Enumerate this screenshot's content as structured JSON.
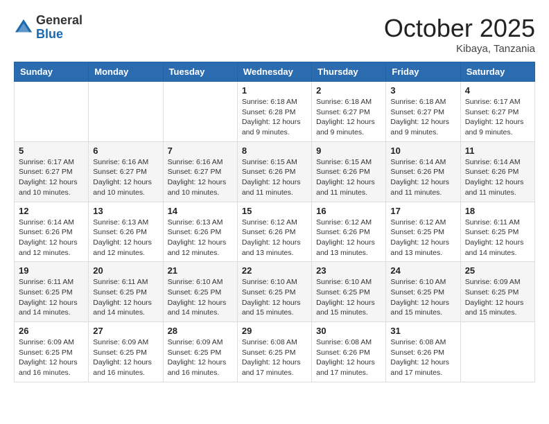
{
  "header": {
    "logo_general": "General",
    "logo_blue": "Blue",
    "month_title": "October 2025",
    "location": "Kibaya, Tanzania"
  },
  "days_of_week": [
    "Sunday",
    "Monday",
    "Tuesday",
    "Wednesday",
    "Thursday",
    "Friday",
    "Saturday"
  ],
  "weeks": [
    [
      {
        "day": "",
        "info": ""
      },
      {
        "day": "",
        "info": ""
      },
      {
        "day": "",
        "info": ""
      },
      {
        "day": "1",
        "info": "Sunrise: 6:18 AM\nSunset: 6:28 PM\nDaylight: 12 hours\nand 9 minutes."
      },
      {
        "day": "2",
        "info": "Sunrise: 6:18 AM\nSunset: 6:27 PM\nDaylight: 12 hours\nand 9 minutes."
      },
      {
        "day": "3",
        "info": "Sunrise: 6:18 AM\nSunset: 6:27 PM\nDaylight: 12 hours\nand 9 minutes."
      },
      {
        "day": "4",
        "info": "Sunrise: 6:17 AM\nSunset: 6:27 PM\nDaylight: 12 hours\nand 9 minutes."
      }
    ],
    [
      {
        "day": "5",
        "info": "Sunrise: 6:17 AM\nSunset: 6:27 PM\nDaylight: 12 hours\nand 10 minutes."
      },
      {
        "day": "6",
        "info": "Sunrise: 6:16 AM\nSunset: 6:27 PM\nDaylight: 12 hours\nand 10 minutes."
      },
      {
        "day": "7",
        "info": "Sunrise: 6:16 AM\nSunset: 6:27 PM\nDaylight: 12 hours\nand 10 minutes."
      },
      {
        "day": "8",
        "info": "Sunrise: 6:15 AM\nSunset: 6:26 PM\nDaylight: 12 hours\nand 11 minutes."
      },
      {
        "day": "9",
        "info": "Sunrise: 6:15 AM\nSunset: 6:26 PM\nDaylight: 12 hours\nand 11 minutes."
      },
      {
        "day": "10",
        "info": "Sunrise: 6:14 AM\nSunset: 6:26 PM\nDaylight: 12 hours\nand 11 minutes."
      },
      {
        "day": "11",
        "info": "Sunrise: 6:14 AM\nSunset: 6:26 PM\nDaylight: 12 hours\nand 11 minutes."
      }
    ],
    [
      {
        "day": "12",
        "info": "Sunrise: 6:14 AM\nSunset: 6:26 PM\nDaylight: 12 hours\nand 12 minutes."
      },
      {
        "day": "13",
        "info": "Sunrise: 6:13 AM\nSunset: 6:26 PM\nDaylight: 12 hours\nand 12 minutes."
      },
      {
        "day": "14",
        "info": "Sunrise: 6:13 AM\nSunset: 6:26 PM\nDaylight: 12 hours\nand 12 minutes."
      },
      {
        "day": "15",
        "info": "Sunrise: 6:12 AM\nSunset: 6:26 PM\nDaylight: 12 hours\nand 13 minutes."
      },
      {
        "day": "16",
        "info": "Sunrise: 6:12 AM\nSunset: 6:26 PM\nDaylight: 12 hours\nand 13 minutes."
      },
      {
        "day": "17",
        "info": "Sunrise: 6:12 AM\nSunset: 6:25 PM\nDaylight: 12 hours\nand 13 minutes."
      },
      {
        "day": "18",
        "info": "Sunrise: 6:11 AM\nSunset: 6:25 PM\nDaylight: 12 hours\nand 14 minutes."
      }
    ],
    [
      {
        "day": "19",
        "info": "Sunrise: 6:11 AM\nSunset: 6:25 PM\nDaylight: 12 hours\nand 14 minutes."
      },
      {
        "day": "20",
        "info": "Sunrise: 6:11 AM\nSunset: 6:25 PM\nDaylight: 12 hours\nand 14 minutes."
      },
      {
        "day": "21",
        "info": "Sunrise: 6:10 AM\nSunset: 6:25 PM\nDaylight: 12 hours\nand 14 minutes."
      },
      {
        "day": "22",
        "info": "Sunrise: 6:10 AM\nSunset: 6:25 PM\nDaylight: 12 hours\nand 15 minutes."
      },
      {
        "day": "23",
        "info": "Sunrise: 6:10 AM\nSunset: 6:25 PM\nDaylight: 12 hours\nand 15 minutes."
      },
      {
        "day": "24",
        "info": "Sunrise: 6:10 AM\nSunset: 6:25 PM\nDaylight: 12 hours\nand 15 minutes."
      },
      {
        "day": "25",
        "info": "Sunrise: 6:09 AM\nSunset: 6:25 PM\nDaylight: 12 hours\nand 15 minutes."
      }
    ],
    [
      {
        "day": "26",
        "info": "Sunrise: 6:09 AM\nSunset: 6:25 PM\nDaylight: 12 hours\nand 16 minutes."
      },
      {
        "day": "27",
        "info": "Sunrise: 6:09 AM\nSunset: 6:25 PM\nDaylight: 12 hours\nand 16 minutes."
      },
      {
        "day": "28",
        "info": "Sunrise: 6:09 AM\nSunset: 6:25 PM\nDaylight: 12 hours\nand 16 minutes."
      },
      {
        "day": "29",
        "info": "Sunrise: 6:08 AM\nSunset: 6:25 PM\nDaylight: 12 hours\nand 17 minutes."
      },
      {
        "day": "30",
        "info": "Sunrise: 6:08 AM\nSunset: 6:26 PM\nDaylight: 12 hours\nand 17 minutes."
      },
      {
        "day": "31",
        "info": "Sunrise: 6:08 AM\nSunset: 6:26 PM\nDaylight: 12 hours\nand 17 minutes."
      },
      {
        "day": "",
        "info": ""
      }
    ]
  ]
}
